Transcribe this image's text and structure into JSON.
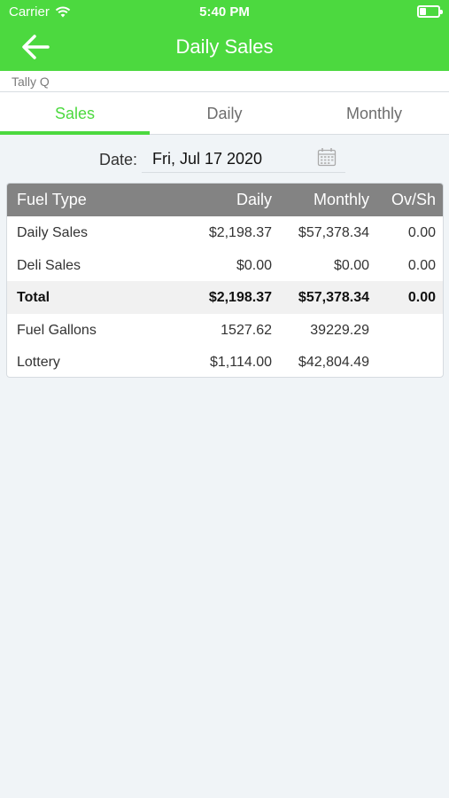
{
  "status": {
    "carrier": "Carrier",
    "time": "5:40 PM"
  },
  "nav": {
    "title": "Daily Sales"
  },
  "account": {
    "name": "Tally Q"
  },
  "tabs": [
    {
      "label": "Sales",
      "active": true
    },
    {
      "label": "Daily",
      "active": false
    },
    {
      "label": "Monthly",
      "active": false
    }
  ],
  "date": {
    "label": "Date:",
    "value": "Fri, Jul 17 2020"
  },
  "table": {
    "headers": {
      "type": "Fuel Type",
      "daily": "Daily",
      "monthly": "Monthly",
      "ovsh": "Ov/Sh"
    },
    "rows": [
      {
        "type": "Daily Sales",
        "daily": "$2,198.37",
        "monthly": "$57,378.34",
        "ovsh": "0.00"
      },
      {
        "type": "Deli Sales",
        "daily": "$0.00",
        "monthly": "$0.00",
        "ovsh": "0.00"
      },
      {
        "type": "Total",
        "daily": "$2,198.37",
        "monthly": "$57,378.34",
        "ovsh": "0.00"
      },
      {
        "type": "Fuel Gallons",
        "daily": "1527.62",
        "monthly": "39229.29",
        "ovsh": ""
      },
      {
        "type": "Lottery",
        "daily": "$1,114.00",
        "monthly": "$42,804.49",
        "ovsh": ""
      }
    ]
  },
  "colors": {
    "accent": "#4cd93f",
    "header_gray": "#838383",
    "background": "#f0f4f7"
  },
  "icons": {
    "back": "arrow-left-icon",
    "calendar": "calendar-icon",
    "wifi": "wifi-icon",
    "battery": "battery-icon"
  }
}
